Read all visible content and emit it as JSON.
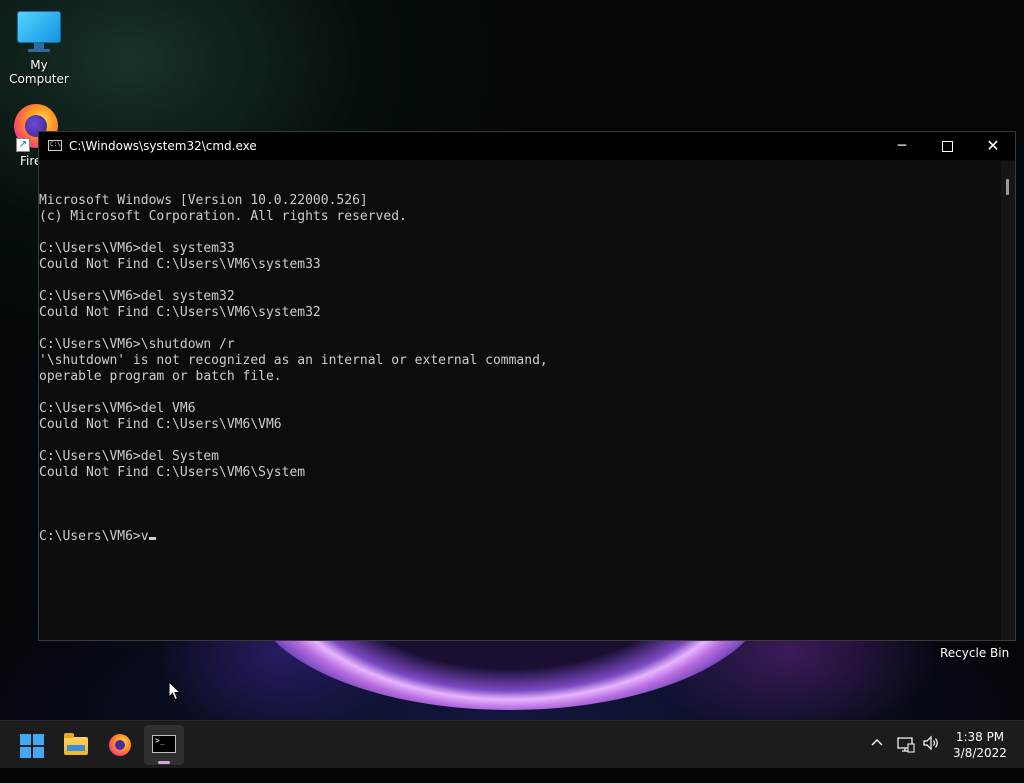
{
  "desktop": {
    "icons": [
      {
        "label": "My Computer"
      },
      {
        "label": "Fire"
      },
      {
        "label": "Recycle Bin"
      }
    ]
  },
  "window": {
    "title": "C:\\Windows\\system32\\cmd.exe",
    "icon_text": "C:\\",
    "controls": {
      "minimize": "─",
      "close": "✕"
    },
    "console_lines": [
      "Microsoft Windows [Version 10.0.22000.526]",
      "(c) Microsoft Corporation. All rights reserved.",
      "",
      "C:\\Users\\VM6>del system33",
      "Could Not Find C:\\Users\\VM6\\system33",
      "",
      "C:\\Users\\VM6>del system32",
      "Could Not Find C:\\Users\\VM6\\system32",
      "",
      "C:\\Users\\VM6>\\shutdown /r",
      "'\\shutdown' is not recognized as an internal or external command,",
      "operable program or batch file.",
      "",
      "C:\\Users\\VM6>del VM6",
      "Could Not Find C:\\Users\\VM6\\VM6",
      "",
      "C:\\Users\\VM6>del System",
      "Could Not Find C:\\Users\\VM6\\System",
      ""
    ],
    "prompt_line": "C:\\Users\\VM6>v"
  },
  "taskbar": {
    "apps": [
      {
        "name": "start-icon"
      },
      {
        "name": "file-explorer-icon"
      },
      {
        "name": "firefox-icon"
      },
      {
        "name": "command-prompt-icon",
        "active": true
      }
    ],
    "tray": {
      "chevron": "^",
      "volume": "🔊"
    },
    "clock": {
      "time": "1:38 PM",
      "date": "3/8/2022"
    }
  },
  "colors": {
    "console_bg": "#0c0c0c",
    "console_text": "#cccccc",
    "taskbar_bg": "#1c1c1c",
    "accent": "#3fa9f5"
  }
}
